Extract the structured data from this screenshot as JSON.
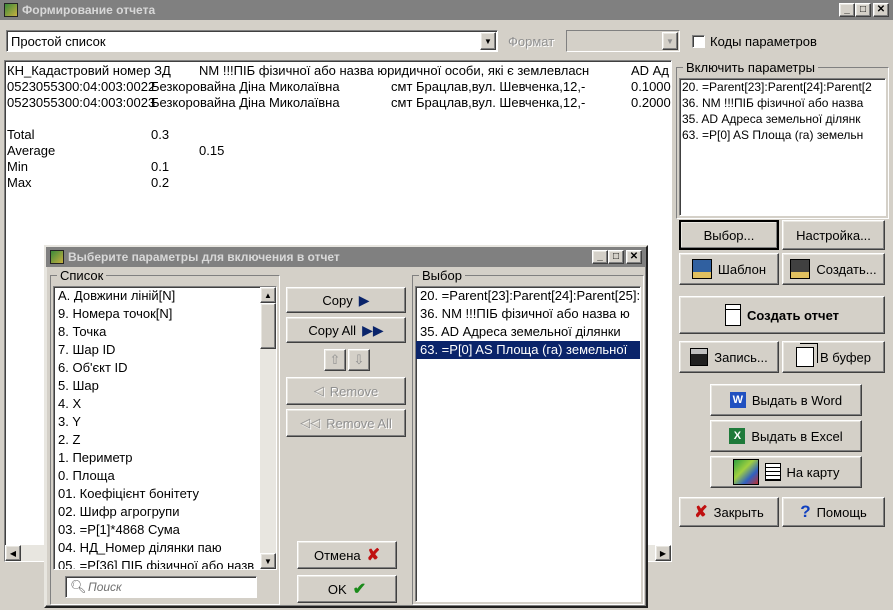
{
  "main_window": {
    "title": "Формирование отчета",
    "report_type_value": "Простой список",
    "format_label": "Формат",
    "format_value": "",
    "codes_label": "Коды параметров",
    "codes_checked": false,
    "table": {
      "header": [
        "КН_Кадастровий номер ЗД",
        "NM !!!ПІБ фізичної або назва юридичної особи, які є землевласн",
        "AD Ад"
      ],
      "rows": [
        [
          "0523055300:04:003:0022",
          "Безкоровайна Діна Миколаївна",
          "смт Брацлав,вул. Шевченка,12,-",
          "0.1000"
        ],
        [
          "0523055300:04:003:0023",
          "Безкоровайна Діна Миколаївна",
          "смт Брацлав,вул. Шевченка,12,-",
          "0.2000"
        ]
      ],
      "stats": [
        {
          "label": "Total",
          "value": "0.3"
        },
        {
          "label": "Average",
          "value": "0.15"
        },
        {
          "label": "Min",
          "value": "0.1"
        },
        {
          "label": "Max",
          "value": "0.2"
        }
      ]
    },
    "include_group_label": "Включить параметры",
    "include_items": [
      "20. =Parent[23]:Parent[24]:Parent[2",
      "36. NM !!!ПІБ фізичної або назва",
      "35. AD Адреса земельної ділянк",
      "63. =P[0] AS Площа (га) земельн"
    ],
    "buttons": {
      "vybor": "Выбор...",
      "nastroyka": "Настройка...",
      "shablon": "Шаблон",
      "sozdat": "Создать...",
      "create_report": "Создать отчет",
      "zapis": "Запись...",
      "v_bufer": "В буфер",
      "word": "Выдать в Word",
      "excel": "Выдать в Excel",
      "map": "На карту",
      "close": "Закрыть",
      "help": "Помощь"
    }
  },
  "dialog": {
    "title": "Выберите параметры для включения в отчет",
    "list_label": "Список",
    "list_items": [
      "A. Довжини ліній[N]",
      "9. Номера точок[N]",
      "8. Точка",
      "7. Шар ID",
      "6. Об'єкт ID",
      "5. Шар",
      "4. X",
      "3. Y",
      "2. Z",
      "1. Периметр",
      "0. Площа",
      "01. Коефіцієнт бонітету",
      "02. Шифр агрогрупи",
      "03. =P[1]*4868 Сума",
      "04. НД_Номер ділянки паю",
      "05. =P[36] ПІБ фізичної або назв"
    ],
    "search_placeholder": "Поиск",
    "choice_label": "Выбор",
    "choice_items": [
      "20. =Parent[23]:Parent[24]:Parent[25]:",
      "36. NM !!!ПІБ фізичної або назва ю",
      "35. AD Адреса земельної ділянки",
      "63. =P[0] AS Площа (га) земельної"
    ],
    "choice_selected_index": 3,
    "buttons": {
      "copy": "Copy",
      "copy_all": "Copy All",
      "remove": "Remove",
      "remove_all": "Remove All",
      "cancel": "Отмена",
      "ok": "OK"
    }
  }
}
